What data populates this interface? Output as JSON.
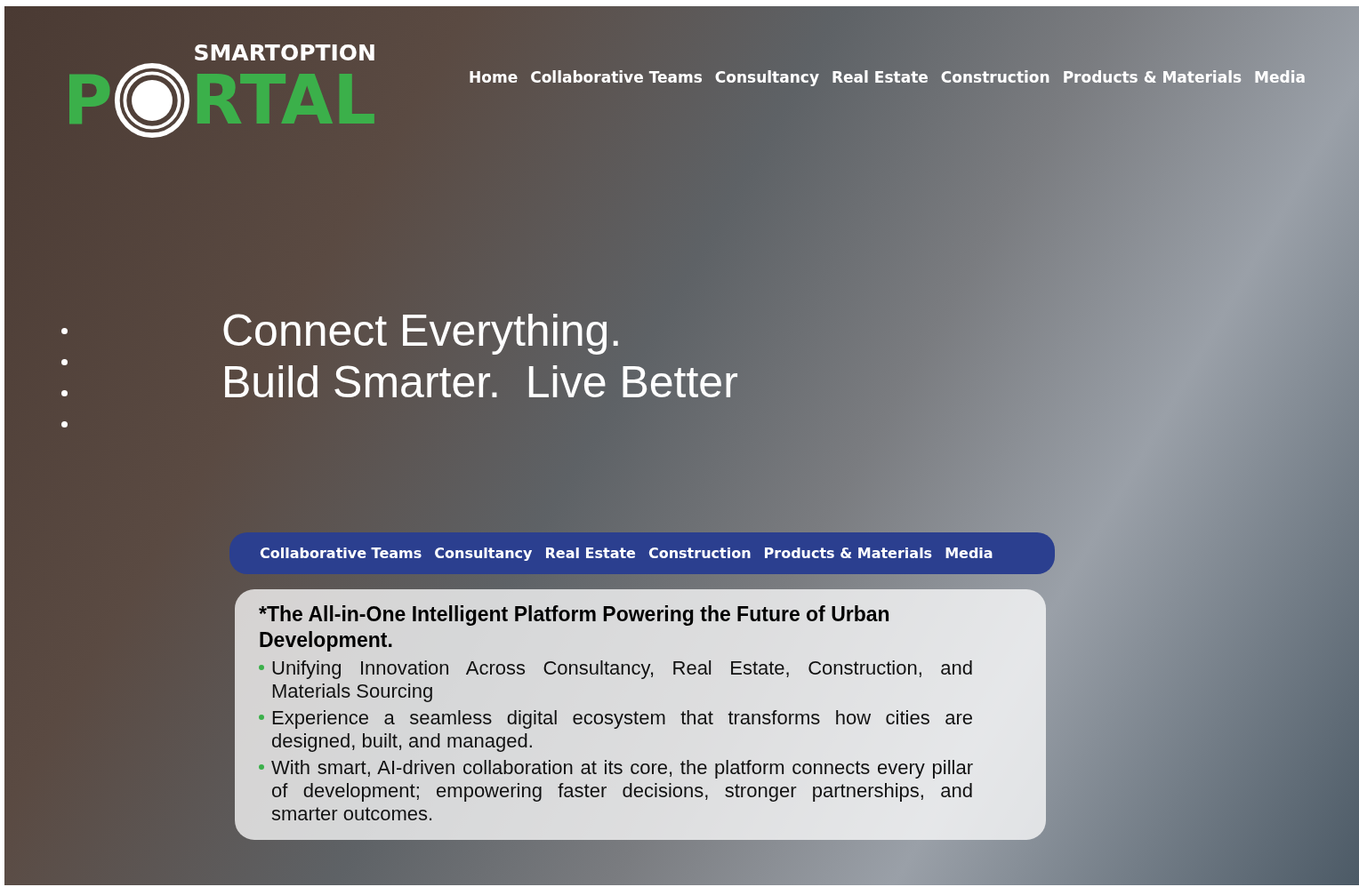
{
  "logo": {
    "top": "SMARTOPTION",
    "before_ring": "P",
    "after_ring": "RTAL"
  },
  "nav": [
    {
      "label": "Home"
    },
    {
      "label": "Collaborative Teams"
    },
    {
      "label": "Consultancy"
    },
    {
      "label": "Real Estate"
    },
    {
      "label": "Construction"
    },
    {
      "label": "Products & Materials"
    },
    {
      "label": "Media"
    }
  ],
  "carousel_dots": [
    {
      "kind": "dot"
    },
    {
      "kind": "dot"
    },
    {
      "kind": "dot"
    },
    {
      "kind": "dot"
    }
  ],
  "headline": [
    "Connect Everything.",
    "Build Smarter.  Live Better"
  ],
  "section_bar": [
    {
      "label": "Collaborative Teams"
    },
    {
      "label": "Consultancy"
    },
    {
      "label": "Real Estate"
    },
    {
      "label": "Construction"
    },
    {
      "label": "Products & Materials"
    },
    {
      "label": "Media"
    }
  ],
  "info_card": {
    "title": "*The All-in-One Intelligent Platform Powering the Future of Urban Development.",
    "bullets": [
      "Unifying Innovation Across Consultancy, Real Estate, Construction, and Materials Sourcing",
      "Experience a seamless digital ecosystem that transforms how cities are designed, built, and managed.",
      "With smart, AI-driven collaboration at its core, the platform connects every pillar of development; empowering faster decisions, stronger partnerships, and smarter outcomes."
    ]
  }
}
